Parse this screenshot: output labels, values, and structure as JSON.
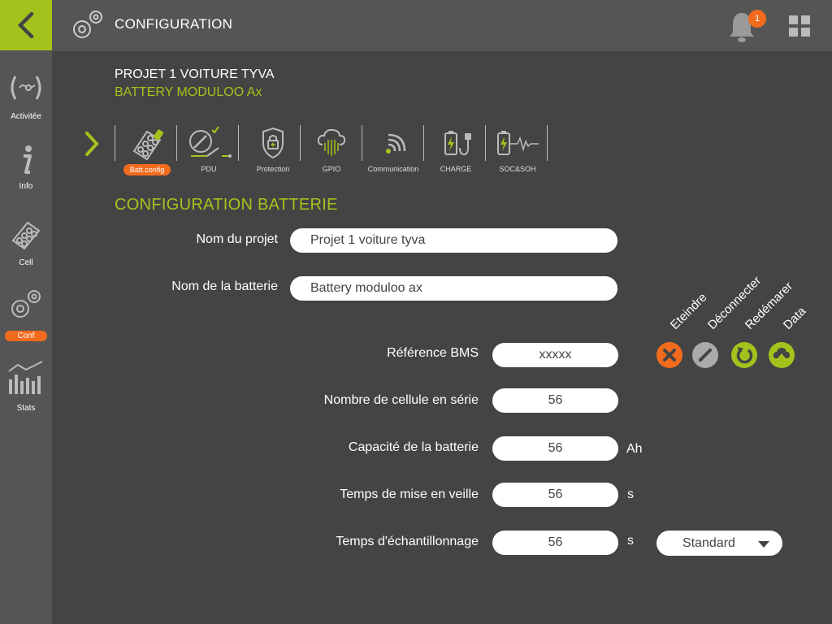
{
  "header": {
    "title": "CONFIGURATION",
    "notification_count": "1"
  },
  "sidebar": {
    "items": [
      {
        "label": "Activitée"
      },
      {
        "label": "Info"
      },
      {
        "label": "Cell"
      },
      {
        "label": "Conf"
      },
      {
        "label": "Stats"
      }
    ]
  },
  "project": {
    "title": "PROJET 1 VOITURE TYVA",
    "subtitle": "BATTERY MODULOO Ax"
  },
  "tabs": [
    {
      "label": "Batt.config"
    },
    {
      "label": "PDU"
    },
    {
      "label": "Protection"
    },
    {
      "label": "GPIO"
    },
    {
      "label": "Communication"
    },
    {
      "label": "CHARGE"
    },
    {
      "label": "SOC&SOH"
    }
  ],
  "section": {
    "title": "CONFIGURATION BATTERIE"
  },
  "form": {
    "project_name": {
      "label": "Nom du projet",
      "value": "Projet 1 voiture tyva"
    },
    "battery_name": {
      "label": "Nom de la batterie",
      "value": "Battery moduloo ax"
    },
    "bms_ref": {
      "label": "Référence BMS",
      "value": "xxxxx"
    },
    "cells_series": {
      "label": "Nombre de cellule en série",
      "value": "56"
    },
    "capacity": {
      "label": "Capacité de la batterie",
      "value": "56",
      "unit": "Ah"
    },
    "sleep_time": {
      "label": "Temps de mise en veille",
      "value": "56",
      "unit": "s"
    },
    "sampling_time": {
      "label": "Temps d'échantillonnage",
      "value": "56",
      "unit": "s"
    },
    "mode": {
      "selected": "Standard"
    }
  },
  "actions": [
    {
      "label": "Eteindre",
      "icon": "close-icon",
      "color": "#f26b1d"
    },
    {
      "label": "Déconnecter",
      "icon": "pencil-icon",
      "color": "#aaaaaa"
    },
    {
      "label": "Redémarer",
      "icon": "restart-icon",
      "color": "#a3c31c"
    },
    {
      "label": "Data",
      "icon": "cloud-icon",
      "color": "#a3c31c"
    }
  ],
  "colors": {
    "accent": "#a3c31c",
    "orange": "#f26b1d",
    "bg": "#444444",
    "panel": "#555555"
  }
}
